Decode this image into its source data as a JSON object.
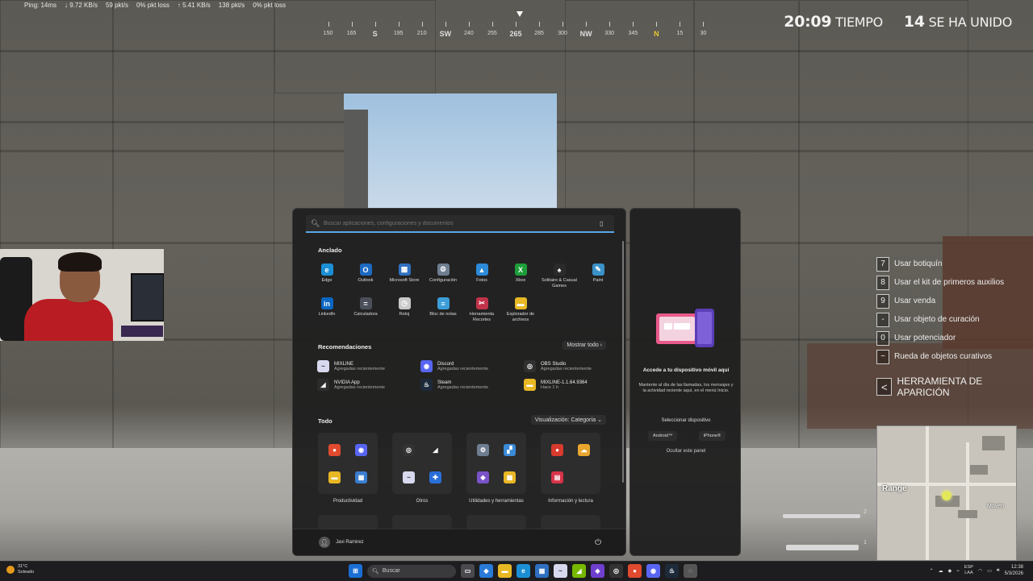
{
  "hud": {
    "ping": "Ping: 14ms",
    "net_down": "↓ 9.72 KB/s",
    "down_pkts": "59 pkt/s",
    "down_loss": "0% pkt loss",
    "net_up": "↑ 5.41 KB/s",
    "up_pkts": "138 pkt/s",
    "up_loss": "0% pkt loss",
    "compass": [
      "150",
      "165",
      "S",
      "195",
      "210",
      "SW",
      "240",
      "255",
      "265",
      "285",
      "300",
      "NW",
      "330",
      "345",
      "N",
      "15",
      "30"
    ],
    "time_value": "20:09",
    "time_label": "TIEMPO",
    "joined_value": "14",
    "joined_label": "SE HA UNIDO",
    "actions": [
      {
        "key": "7",
        "label": "Usar botiquín"
      },
      {
        "key": "8",
        "label": "Usar el kit de primeros auxilios"
      },
      {
        "key": "9",
        "label": "Usar venda"
      },
      {
        "key": "-",
        "label": "Usar objeto de curación"
      },
      {
        "key": "0",
        "label": "Usar potenciador"
      },
      {
        "key": "~",
        "label": "Rueda de objetos curativos"
      }
    ],
    "spawn_key": "<",
    "spawn_label": "HERRAMIENTA DE APARICIÓN",
    "minimap_label": "Range",
    "minimap_label2": "Moven",
    "weapon_slot_1": "2",
    "weapon_slot_2": "1"
  },
  "start_menu": {
    "search_placeholder": "Buscar aplicaciones, configuraciones y documentos",
    "pinned_title": "Anclado",
    "pinned": [
      {
        "label": "Edge",
        "color": "#1b8fd6",
        "glyph": "e"
      },
      {
        "label": "Outlook",
        "color": "#1d6ac2",
        "glyph": "O"
      },
      {
        "label": "Microsoft Store",
        "color": "#2f6fbf",
        "glyph": "▦"
      },
      {
        "label": "Configuración",
        "color": "#6e7e90",
        "glyph": "⚙"
      },
      {
        "label": "Fotos",
        "color": "#2c8ad8",
        "glyph": "▲"
      },
      {
        "label": "Xbox",
        "color": "#1e9e3a",
        "glyph": "X"
      },
      {
        "label": "Solitaire & Casual Games",
        "color": "#2a2a2a",
        "glyph": "♠"
      },
      {
        "label": "Paint",
        "color": "#3a92c8",
        "glyph": "✎"
      },
      {
        "label": "LinkedIn",
        "color": "#0a66c2",
        "glyph": "in"
      },
      {
        "label": "Calculadora",
        "color": "#4a4f5a",
        "glyph": "="
      },
      {
        "label": "Reloj",
        "color": "#c9c9c9",
        "glyph": "◷"
      },
      {
        "label": "Bloc de notas",
        "color": "#3c9ed8",
        "glyph": "≡"
      },
      {
        "label": "Herramienta Recortes",
        "color": "#c0334a",
        "glyph": "✂"
      },
      {
        "label": "Explorador de archivos",
        "color": "#e8b724",
        "glyph": "▬"
      }
    ],
    "rec_title": "Recomendaciones",
    "rec_link": "Mostrar todo ›",
    "recs": [
      {
        "name": "MIXLINE",
        "sub": "Agregadas recientemente",
        "color": "#d8d8ee",
        "glyph": "~"
      },
      {
        "name": "Discord",
        "sub": "Agregadas recientemente",
        "color": "#5865f2",
        "glyph": "◉"
      },
      {
        "name": "OBS Studio",
        "sub": "Agregadas recientemente",
        "color": "#303030",
        "glyph": "◎"
      },
      {
        "name": "NVIDIA App",
        "sub": "Agregadas recientemente",
        "color": "#2d2d2d",
        "glyph": "◢"
      },
      {
        "name": "Steam",
        "sub": "Agregadas recientemente",
        "color": "#1d2a3a",
        "glyph": "♨"
      },
      {
        "name": "MIXLINE-1.1.64.9364",
        "sub": "Hace 1 h",
        "color": "#e8b724",
        "glyph": "▬"
      }
    ],
    "all_title": "Todo",
    "view_label": "Visualización: Categoría ⌄",
    "categories": [
      {
        "label": "Productividad",
        "icons": [
          [
            "#e04a2e",
            "●"
          ],
          [
            "#5865f2",
            "◉"
          ],
          [
            "#e8b724",
            "▬"
          ],
          [
            "#3a7ed0",
            "▦"
          ]
        ]
      },
      {
        "label": "Otros",
        "icons": [
          [
            "#333",
            "◎"
          ],
          [
            "#2d2d2d",
            "◢"
          ],
          [
            "#d8d8ee",
            "~"
          ],
          [
            "#2a6fd8",
            "✚"
          ]
        ]
      },
      {
        "label": "Utilidades y herramientas",
        "icons": [
          [
            "#6e7e90",
            "⚙"
          ],
          [
            "#3a8ad8",
            "▞"
          ],
          [
            "#7a52c8",
            "◈"
          ],
          [
            "#e8b724",
            "▦"
          ]
        ]
      },
      {
        "label": "Información y lectura",
        "icons": [
          [
            "#d83a2e",
            "●"
          ],
          [
            "#e8a62c",
            "☁"
          ],
          [
            "#d8334a",
            "▤"
          ],
          [
            "#2d2d2d",
            ""
          ]
        ]
      }
    ],
    "user_name": "Javi Ramirez",
    "phone": {
      "title": "Accede a tu dispositivo móvil aquí",
      "desc": "Mantente al día de las llamadas, los mensajes y la actividad reciente aquí, en el menú Inicio.",
      "select": "Seleccionar dispositivo",
      "android": "Android™",
      "iphone": "iPhone®",
      "hide": "Ocultar este panel"
    }
  },
  "taskbar": {
    "temp": "31°C",
    "weather": "Soleado",
    "search": "Buscar",
    "apps": [
      {
        "name": "task-view",
        "color": "#4a4a4e",
        "glyph": "▭"
      },
      {
        "name": "copilot",
        "color": "#2a7ad8",
        "glyph": "◆"
      },
      {
        "name": "explorer",
        "color": "#e8b724",
        "glyph": "▬"
      },
      {
        "name": "edge",
        "color": "#1b8fd6",
        "glyph": "e"
      },
      {
        "name": "store",
        "color": "#2f6fbf",
        "glyph": "▦"
      },
      {
        "name": "mixline",
        "color": "#d8d8ee",
        "glyph": "~"
      },
      {
        "name": "nvidia",
        "color": "#76b900",
        "glyph": "◢"
      },
      {
        "name": "app-purple",
        "color": "#6f3fd0",
        "glyph": "◈"
      },
      {
        "name": "obs",
        "color": "#333",
        "glyph": "◎"
      },
      {
        "name": "chrome",
        "color": "#e04a2e",
        "glyph": "●"
      },
      {
        "name": "discord",
        "color": "#5865f2",
        "glyph": "◉"
      },
      {
        "name": "steam",
        "color": "#1d2a3a",
        "glyph": "♨"
      },
      {
        "name": "app-gray",
        "color": "#555",
        "glyph": "◌"
      }
    ],
    "lang_top": "ESP",
    "lang_bottom": "LAA",
    "time": "12:38",
    "date": "5/3/2026"
  }
}
